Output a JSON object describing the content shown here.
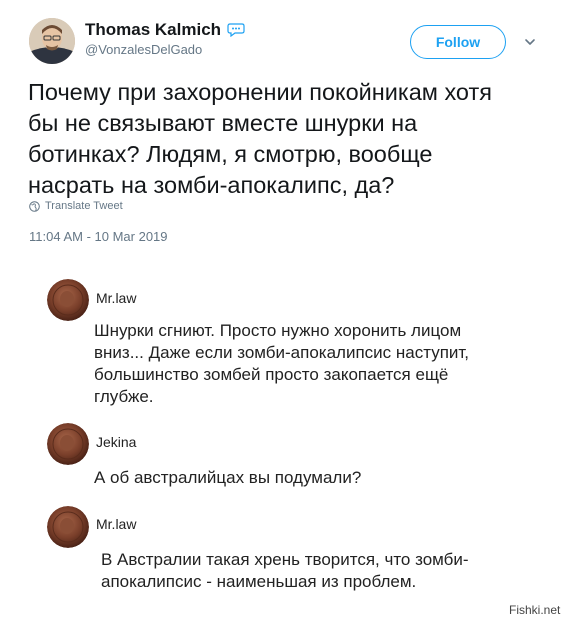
{
  "tweet": {
    "author": {
      "display_name": "Thomas Kalmich",
      "handle": "@VonzalesDelGado"
    },
    "follow_label": "Follow",
    "text_lines": [
      "Почему при захоронении покойникам хотя",
      "бы не связывают вместе шнурки на",
      "ботинках? Людям, я смотрю, вообще",
      "насрать на зомби-апокалипс, да?"
    ],
    "translate_label": "Translate Tweet",
    "timestamp": "11:04 AM - 10 Mar 2019",
    "icons": {
      "avatar": "author-avatar",
      "bubble": "speech-bubble-icon",
      "chevron": "chevron-down-icon",
      "globe": "globe-icon"
    },
    "colors": {
      "accent": "#1da1f2",
      "muted": "#657786"
    }
  },
  "comments": [
    {
      "author": "Mr.law",
      "text_lines": [
        "Шнурки сгниют. Просто нужно хоронить лицом",
        "вниз... Даже если зомби-апокалипсис наступит,",
        "большинство зомбей просто закопается ещё",
        "глубже."
      ]
    },
    {
      "author": "Jekina",
      "text_lines": [
        "А об австралийцах вы подумали?"
      ]
    },
    {
      "author": "Mr.law",
      "text_lines": [
        "В Австралии такая хрень творится, что зомби-",
        "апокалипсис - наименьшая из проблем."
      ]
    }
  ],
  "watermark": "Fishki.net"
}
